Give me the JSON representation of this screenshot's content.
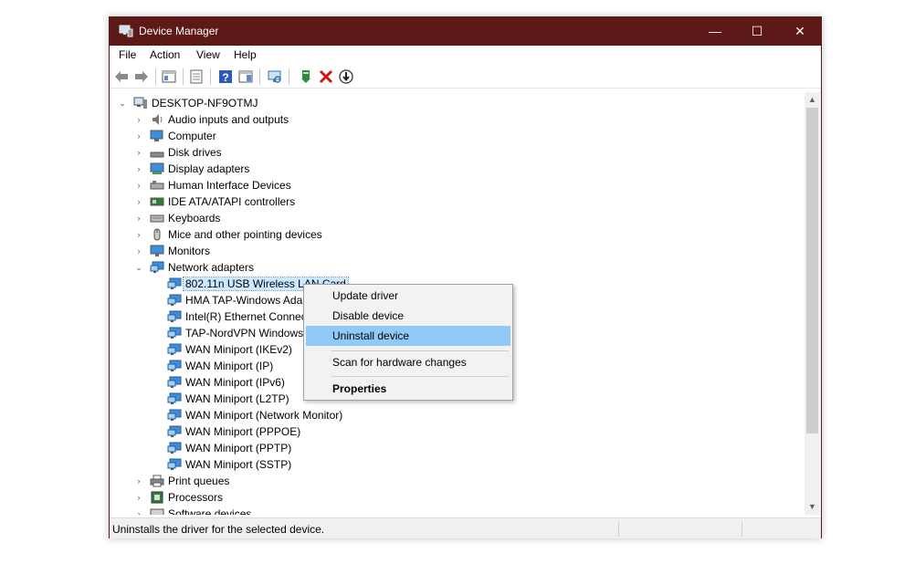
{
  "window": {
    "title": "Device Manager",
    "controls": {
      "minimize": "—",
      "maximize": "☐",
      "close": "✕"
    }
  },
  "menu": [
    "File",
    "Action",
    "View",
    "Help"
  ],
  "toolbar": {
    "buttons": [
      "back-icon",
      "forward-icon",
      "show-hide-console-tree-icon",
      "properties-icon",
      "help-icon",
      "action-pane-icon",
      "scan-hardware-icon",
      "update-driver-icon",
      "uninstall-icon",
      "disable-device-icon"
    ]
  },
  "tree": {
    "root": "DESKTOP-NF9OTMJ",
    "categories": [
      {
        "label": "Audio inputs and outputs",
        "icon": "speaker-icon"
      },
      {
        "label": "Computer",
        "icon": "computer-icon"
      },
      {
        "label": "Disk drives",
        "icon": "disk-drive-icon"
      },
      {
        "label": "Display adapters",
        "icon": "display-adapter-icon"
      },
      {
        "label": "Human Interface Devices",
        "icon": "hid-icon"
      },
      {
        "label": "IDE ATA/ATAPI controllers",
        "icon": "ide-controller-icon"
      },
      {
        "label": "Keyboards",
        "icon": "keyboard-icon"
      },
      {
        "label": "Mice and other pointing devices",
        "icon": "mouse-icon"
      },
      {
        "label": "Monitors",
        "icon": "monitor-icon"
      },
      {
        "label": "Network adapters",
        "icon": "network-adapter-icon"
      }
    ],
    "network_adapters": [
      "802.11n USB Wireless LAN Card",
      "HMA TAP-Windows Ada",
      "Intel(R) Ethernet Connec",
      "TAP-NordVPN Windows",
      "WAN Miniport (IKEv2)",
      "WAN Miniport (IP)",
      "WAN Miniport (IPv6)",
      "WAN Miniport (L2TP)",
      "WAN Miniport (Network Monitor)",
      "WAN Miniport (PPPOE)",
      "WAN Miniport (PPTP)",
      "WAN Miniport (SSTP)"
    ],
    "after": [
      {
        "label": "Print queues",
        "icon": "printer-icon"
      },
      {
        "label": "Processors",
        "icon": "processor-icon"
      },
      {
        "label": "Software devices",
        "icon": "software-device-icon"
      }
    ]
  },
  "context_menu": {
    "items": [
      "Update driver",
      "Disable device",
      "Uninstall device",
      "Scan for hardware changes",
      "Properties"
    ],
    "highlighted": "Uninstall device"
  },
  "status": {
    "text": "Uninstalls the driver for the selected device."
  },
  "colors": {
    "titlebar": "#5c1917",
    "selection": "#cce8ff",
    "menu_highlight": "#91c9f7"
  }
}
